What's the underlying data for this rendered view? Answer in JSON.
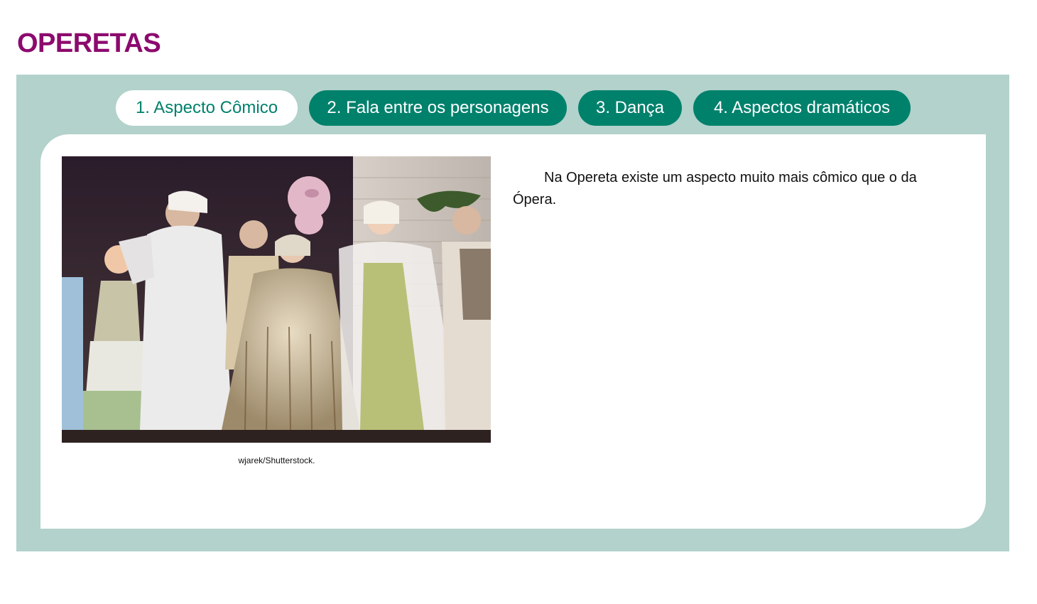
{
  "page": {
    "title": "OPERETAS"
  },
  "tabs": [
    {
      "label": "1. Aspecto Cômico",
      "active": true
    },
    {
      "label": "2. Fala entre os personagens",
      "active": false
    },
    {
      "label": "3. Dança",
      "active": false
    },
    {
      "label": "4. Aspectos dramáticos",
      "active": false
    }
  ],
  "content": {
    "image_description": "operetta-stage-photo",
    "caption": "wjarek/Shutterstock.",
    "text": "Na Opereta existe um aspecto muito mais cômico que o da Ópera."
  },
  "colors": {
    "title": "#8c0a6e",
    "panel_background": "#b2d2cb",
    "tab_active_bg": "#ffffff",
    "tab_inactive_bg": "#00816c",
    "tab_active_text": "#00816c",
    "tab_inactive_text": "#ffffff"
  }
}
